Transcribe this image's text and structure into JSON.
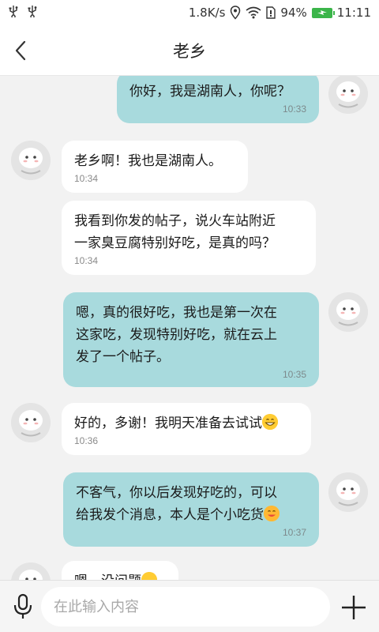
{
  "status_bar": {
    "speed": "1.8K/s",
    "battery_percent": "94%",
    "time": "11:11",
    "icons": [
      "usb-icon",
      "usb-icon",
      "location-icon",
      "wifi-icon",
      "sim-icon",
      "battery-icon"
    ]
  },
  "header": {
    "title": "老乡",
    "back_icon": "chevron-left-icon"
  },
  "messages": [
    {
      "from": "me",
      "text": "你好，我是湖南人，你呢？",
      "time": "10:33"
    },
    {
      "from": "other",
      "text": "老乡啊！我也是湖南人。",
      "time": "10:34"
    },
    {
      "from": "other",
      "text_lines": [
        "我看到你发的帖子，说火车站附近",
        "一家臭豆腐特别好吃，是真的吗？"
      ],
      "time": "10:34"
    },
    {
      "from": "me",
      "text_lines": [
        "嗯，真的很好吃，我也是第一次在",
        "这家吃，发现特别好吃，就在云上",
        "发了一个帖子。"
      ],
      "time": "10:35"
    },
    {
      "from": "other",
      "text": "好的，多谢！我明天准备去试试",
      "emoji": "grin-emoji",
      "time": "10:36"
    },
    {
      "from": "me",
      "text_lines": [
        "不客气，你以后发现好吃的，可以",
        "给我发个消息，本人是个小吃货"
      ],
      "emoji": "smile-emoji",
      "time": "10:37"
    },
    {
      "from": "other",
      "text": "嗯，没问题",
      "emoji": "smile-emoji",
      "partial": true
    }
  ],
  "input_bar": {
    "placeholder": "在此输入内容",
    "mic_icon": "microphone-icon",
    "plus_icon": "plus-icon"
  }
}
